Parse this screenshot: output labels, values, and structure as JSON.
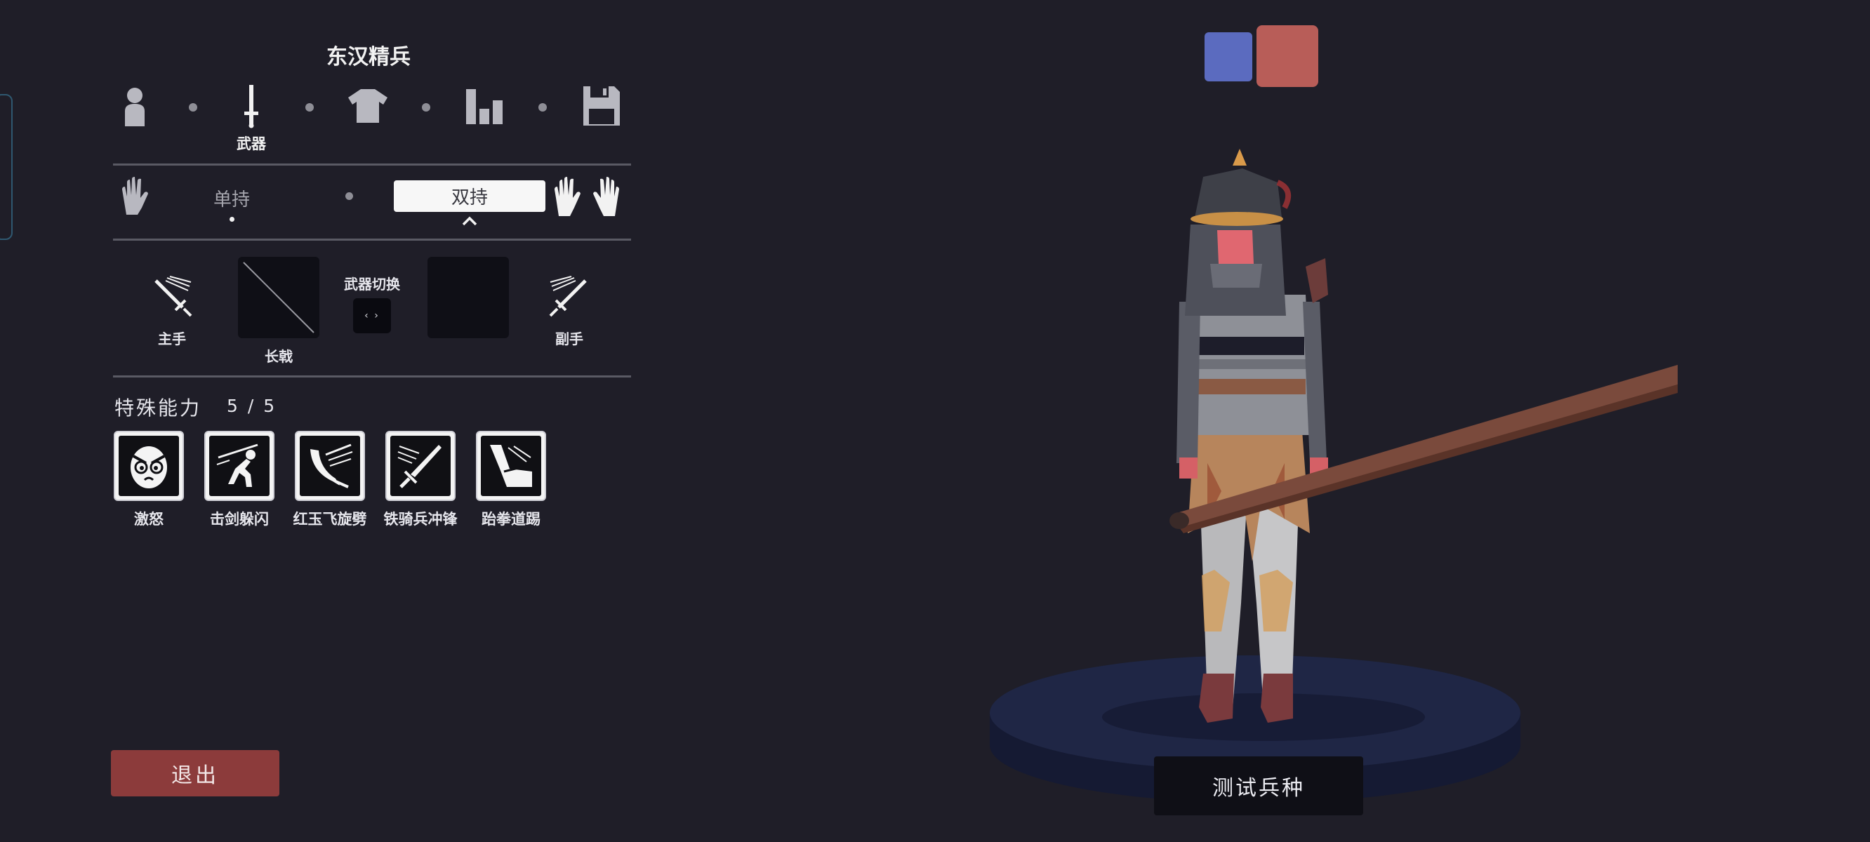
{
  "unit_title": "东汉精兵",
  "nav": {
    "tabs": [
      {
        "icon": "unit-icon"
      },
      {
        "icon": "sword-icon",
        "label": "武器",
        "active": true
      },
      {
        "icon": "shirt-icon"
      },
      {
        "icon": "stats-icon"
      },
      {
        "icon": "save-icon"
      }
    ]
  },
  "hold_mode": {
    "one_hand": "单持",
    "two_hand": "双持",
    "selected": "双持"
  },
  "weapons": {
    "main_hand_label": "主手",
    "main_weapon_name": "长戟",
    "swap_label": "武器切换",
    "swap_glyph": "‹ ›",
    "off_hand_label": "副手"
  },
  "abilities": {
    "title": "特殊能力",
    "count": "5 / 5",
    "items": [
      {
        "label": "激怒",
        "icon": "angry-face-icon"
      },
      {
        "label": "击剑躲闪",
        "icon": "dodge-icon"
      },
      {
        "label": "红玉飞旋劈",
        "icon": "spin-slash-icon"
      },
      {
        "label": "铁骑兵冲锋",
        "icon": "charge-sword-icon"
      },
      {
        "label": "跆拳道踢",
        "icon": "kick-icon"
      }
    ]
  },
  "team_colors": {
    "blue": "#5b6bbf",
    "red": "#b85d58",
    "selected": "red"
  },
  "exit_label": "退出",
  "test_label": "测试兵种"
}
